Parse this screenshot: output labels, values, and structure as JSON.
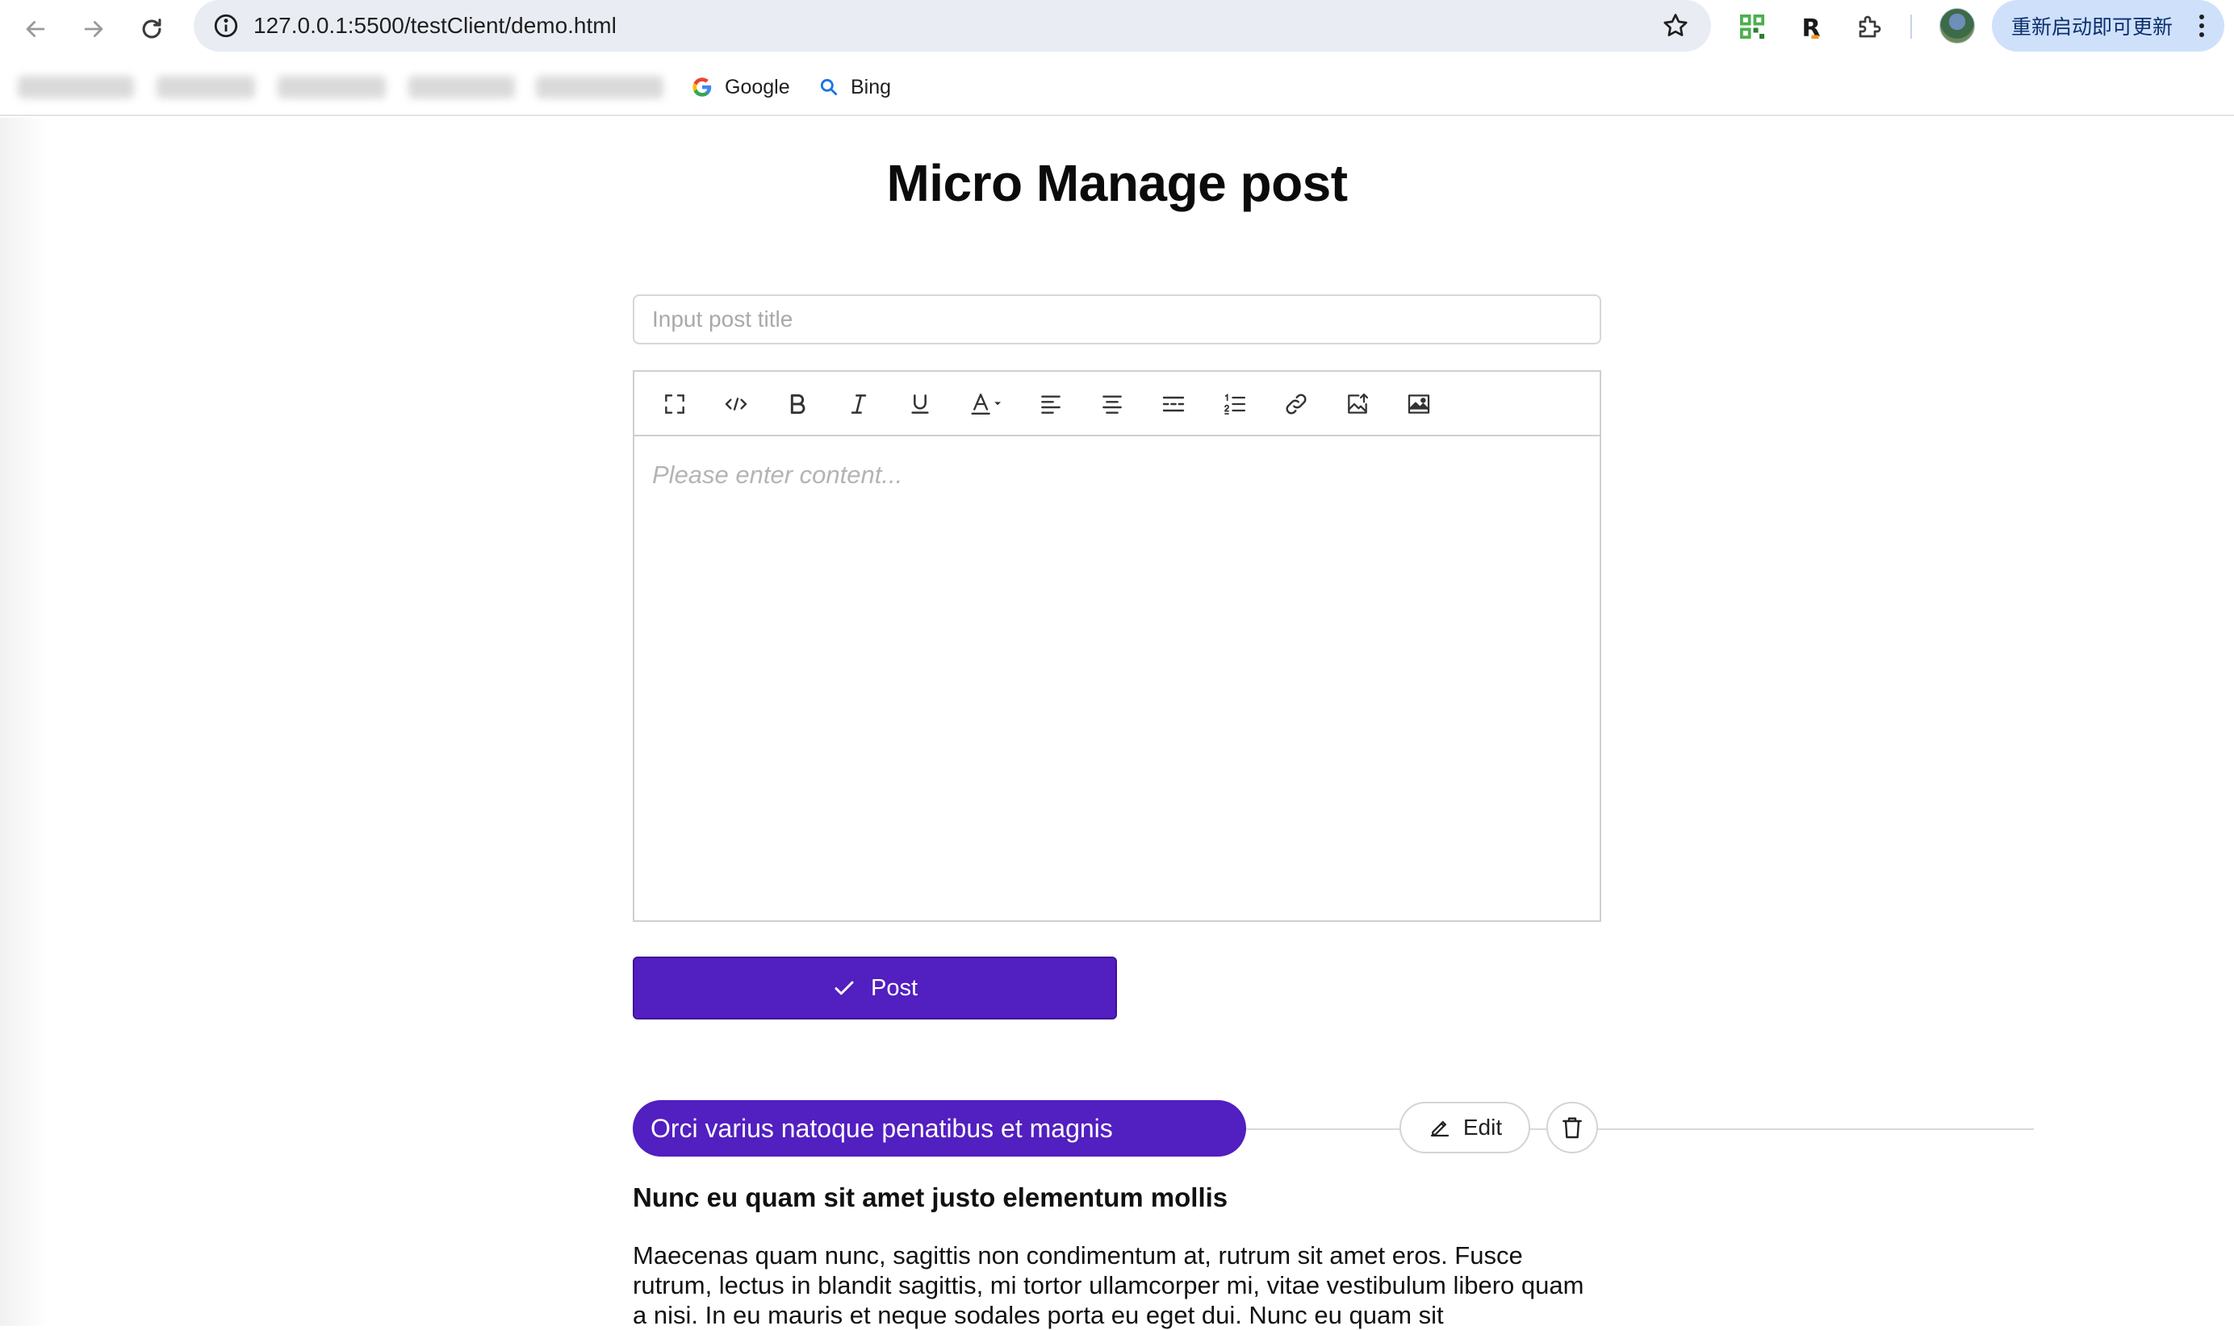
{
  "browser": {
    "url": "127.0.0.1:5500/testClient/demo.html",
    "update_label": "重新启动即可更新",
    "bookmarks": [
      {
        "label": "Google",
        "icon": "google-icon"
      },
      {
        "label": "Bing",
        "icon": "search-icon"
      }
    ]
  },
  "page": {
    "title": "Micro Manage post",
    "title_input_placeholder": "Input post title",
    "editor_placeholder": "Please enter content...",
    "post_button_label": "Post"
  },
  "post": {
    "title": "Orci varius natoque penatibus et magnis",
    "edit_label": "Edit",
    "subtitle": "Nunc eu quam sit amet justo elementum mollis",
    "body": "Maecenas quam nunc, sagittis non condimentum at, rutrum sit amet eros. Fusce rutrum, lectus in blandit sagittis, mi tortor ullamcorper mi, vitae vestibulum libero quam a nisi. In eu mauris et neque sodales porta eu eget dui. Nunc eu quam sit"
  },
  "colors": {
    "accent": "#521fc0",
    "omnibox_bg": "#e9edf3",
    "update_bg": "#cfe0fb"
  }
}
